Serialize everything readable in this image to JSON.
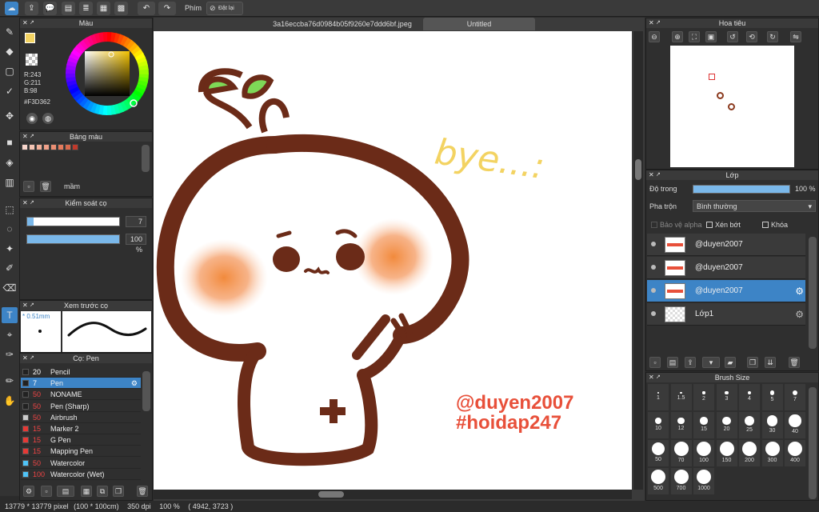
{
  "toolbar": {
    "shortcut_label": "Phím",
    "reset_label": "Đặt lại"
  },
  "tabs": {
    "file_tab": "3a16eccba76d0984b05f9260e7ddd6bf.jpeg",
    "untitled_tab": "Untitled"
  },
  "color_panel": {
    "title": "Màu",
    "r": "R:243",
    "g": "G:211",
    "b": "B:98",
    "hex": "#F3D362",
    "main_color": "#f3d362",
    "sub_color": "#7a2ab0"
  },
  "palette_panel": {
    "title": "Bảng màu",
    "palette_name": "mầm",
    "swatches": [
      "#f8d6cc",
      "#f5c4b3",
      "#f2b09a",
      "#efa089",
      "#eb8f74",
      "#e47b5d",
      "#d86a4d",
      "#c0392b"
    ]
  },
  "brush_control": {
    "title": "Kiểm soát cọ",
    "size_value": "7",
    "opacity_value": "100 %",
    "size_fraction": 0.07,
    "opacity_fraction": 1.0
  },
  "brush_preview": {
    "title": "Xem trước cọ",
    "size_label": "* 0.51mm"
  },
  "brush_list": {
    "title": "Cọ: Pen",
    "items": [
      {
        "size": "20",
        "name": "Pencil",
        "color": "#222222"
      },
      {
        "size": "7",
        "name": "Pen",
        "color": "#222222"
      },
      {
        "size": "50",
        "name": "NONAME",
        "color": "#222222"
      },
      {
        "size": "50",
        "name": "Pen (Sharp)",
        "color": "#222222"
      },
      {
        "size": "50",
        "name": "Airbrush",
        "color": "#cccccc"
      },
      {
        "size": "15",
        "name": "Marker 2",
        "color": "#e53935"
      },
      {
        "size": "15",
        "name": "G Pen",
        "color": "#e53935"
      },
      {
        "size": "15",
        "name": "Mapping Pen",
        "color": "#e53935"
      },
      {
        "size": "50",
        "name": "Watercolor",
        "color": "#4fc3f7"
      },
      {
        "size": "100",
        "name": "Watercolor (Wet)",
        "color": "#4fc3f7"
      }
    ]
  },
  "navigator": {
    "title": "Hoa tiêu"
  },
  "layers_panel": {
    "title": "Lớp",
    "opacity_label": "Độ trong",
    "opacity_value": "100 %",
    "opacity_fraction": 1.0,
    "blend_label": "Pha trộn",
    "blend_value": "Bình thường",
    "protect_alpha": "Bảo vệ alpha",
    "clipping": "Xén bớt",
    "lock": "Khóa",
    "layers": [
      {
        "name": "@duyen2007"
      },
      {
        "name": "@duyen2007"
      },
      {
        "name": "@duyen2007"
      },
      {
        "name": "Lớp1"
      }
    ]
  },
  "brush_size_panel": {
    "title": "Brush Size",
    "sizes": [
      "1",
      "1.5",
      "2",
      "3",
      "4",
      "5",
      "7",
      "10",
      "12",
      "15",
      "20",
      "25",
      "30",
      "40",
      "50",
      "70",
      "100",
      "150",
      "200",
      "300",
      "400",
      "500",
      "700",
      "1000"
    ]
  },
  "canvas_text": {
    "bye": "bye...:",
    "handle1": "@duyen2007",
    "handle2": "#hoidap247"
  },
  "status": {
    "pixel_size": "13779 * 13779 pixel",
    "cm_size": "(100 * 100cm)",
    "dpi": "350 dpi",
    "zoom": "100 %",
    "coords": "( 4942, 3723 )"
  }
}
